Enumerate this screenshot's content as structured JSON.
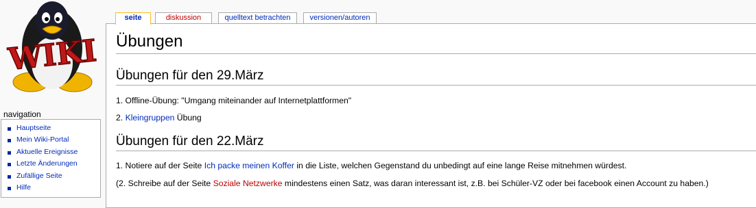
{
  "logo": {
    "text": "WIKI"
  },
  "tabs": [
    {
      "label": "seite",
      "selected": true
    },
    {
      "label": "diskussion",
      "new": true
    },
    {
      "label": "quelltext betrachten"
    },
    {
      "label": "versionen/autoren"
    }
  ],
  "page": {
    "title": "Übungen",
    "section1": {
      "heading": "Übungen für den 29.März",
      "item1": "1. Offline-Übung: \"Umgang miteinander auf Internetplattformen\"",
      "item2_prefix": "2. ",
      "item2_link": "Kleingruppen",
      "item2_suffix": " Übung"
    },
    "section2": {
      "heading": "Übungen für den 22.März",
      "p1_prefix": "1. Notiere auf der Seite ",
      "p1_link": "Ich packe meinen Koffer",
      "p1_suffix": " in die Liste, welchen Gegenstand du unbedingt auf eine lange Reise mitnehmen würdest.",
      "p2_prefix": "(2. Schreibe auf der Seite ",
      "p2_link": "Soziale Netzwerke",
      "p2_suffix": " mindestens einen Satz, was daran interessant ist, z.B. bei Schüler-VZ oder bei facebook einen Account zu haben.)"
    }
  },
  "navigation": {
    "title": "navigation",
    "items": [
      "Hauptseite",
      "Mein Wiki-Portal",
      "Aktuelle Ereignisse",
      "Letzte Änderungen",
      "Zufällige Seite",
      "Hilfe"
    ]
  },
  "colors": {
    "link": "#002bb8",
    "new_link": "#ba0000",
    "selected_tab_border": "#fabd23"
  }
}
